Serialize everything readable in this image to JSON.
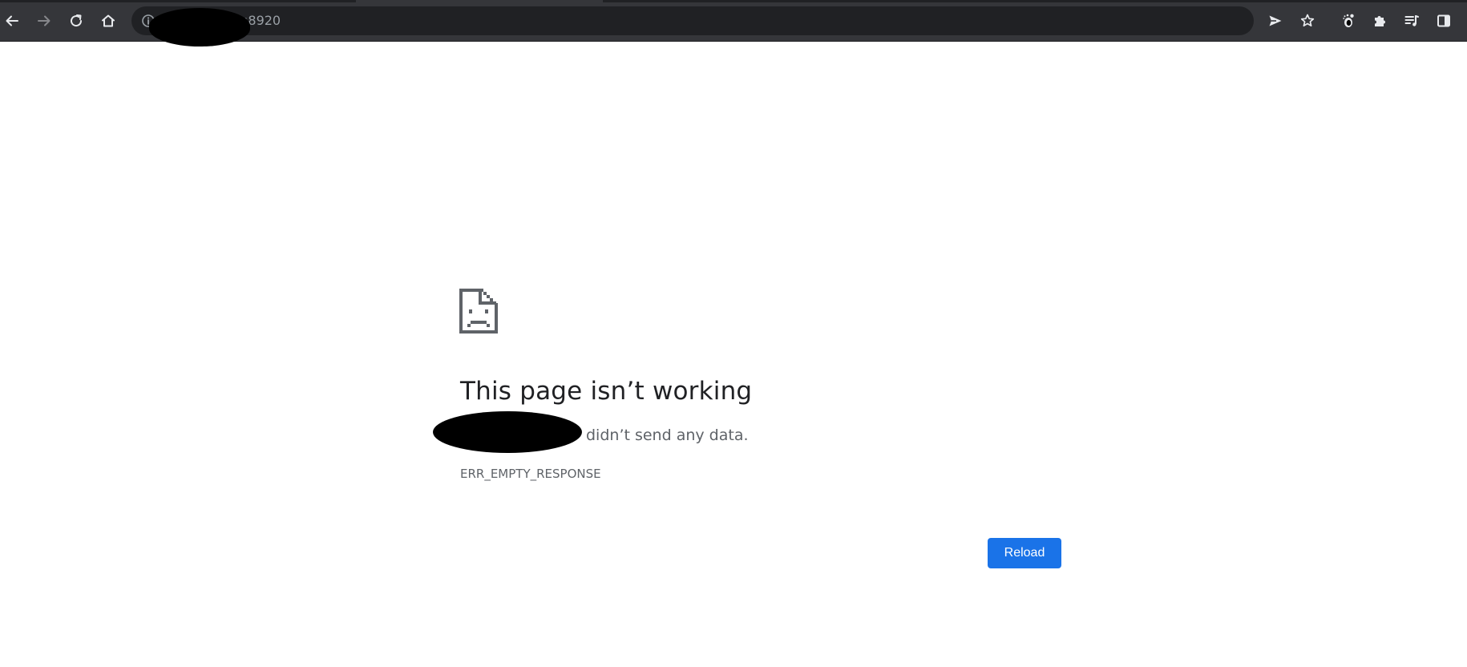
{
  "browser": {
    "url_visible_suffix": ":8920",
    "toolbar_icons": {
      "back": "arrow-left-icon",
      "forward": "arrow-right-icon",
      "reload": "reload-icon",
      "home": "home-icon",
      "site_info": "info-icon",
      "send": "send-icon",
      "bookmark": "star-icon",
      "extension_a": "gnome-icon",
      "extensions": "puzzle-icon",
      "reading_list": "reading-list-icon",
      "side_panel": "side-panel-icon"
    },
    "colors": {
      "toolbar_bg": "#35363a",
      "omnibox_bg": "#202124",
      "icon": "#e8eaed"
    }
  },
  "error_page": {
    "icon": "sad-page-icon",
    "title": "This page isn’t working",
    "message_suffix": " didn’t send any data.",
    "error_code": "ERR_EMPTY_RESPONSE",
    "reload_label": "Reload",
    "colors": {
      "title": "#202124",
      "secondary_text": "#5f6368",
      "button": "#1a73e8"
    }
  }
}
